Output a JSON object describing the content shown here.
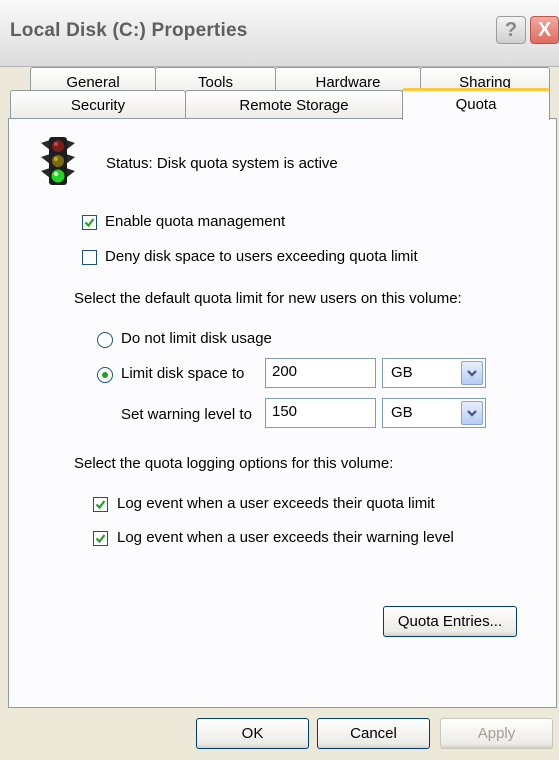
{
  "window": {
    "title": "Local Disk (C:) Properties",
    "help_label": "?",
    "close_label": "X"
  },
  "tabs": {
    "general": "General",
    "tools": "Tools",
    "hardware": "Hardware",
    "sharing": "Sharing",
    "security": "Security",
    "remote_storage": "Remote Storage",
    "quota": "Quota"
  },
  "quota": {
    "status": "Status:  Disk quota system is active",
    "enable_label": "Enable quota management",
    "enable_checked": true,
    "deny_label": "Deny disk space to users exceeding quota limit",
    "deny_checked": false,
    "default_limit_heading": "Select the default quota limit for new users on this volume:",
    "no_limit_label": "Do not limit disk usage",
    "limit_label": "Limit disk space to",
    "limit_value": "200",
    "limit_unit": "GB",
    "warning_label": "Set warning level to",
    "warning_value": "150",
    "warning_unit": "GB",
    "logging_heading": "Select the quota logging options for this volume:",
    "log_limit_label": "Log event when a user exceeds their quota limit",
    "log_limit_checked": true,
    "log_warning_label": "Log event when a user exceeds their warning level",
    "log_warning_checked": true,
    "entries_button": "Quota Entries..."
  },
  "footer": {
    "ok": "OK",
    "cancel": "Cancel",
    "apply": "Apply"
  },
  "icons": {
    "status": "traffic-light-icon",
    "check": "checkmark-icon",
    "dropdown": "chevron-down-icon"
  },
  "colors": {
    "accent": "#ffc83c",
    "check": "#21a121"
  }
}
